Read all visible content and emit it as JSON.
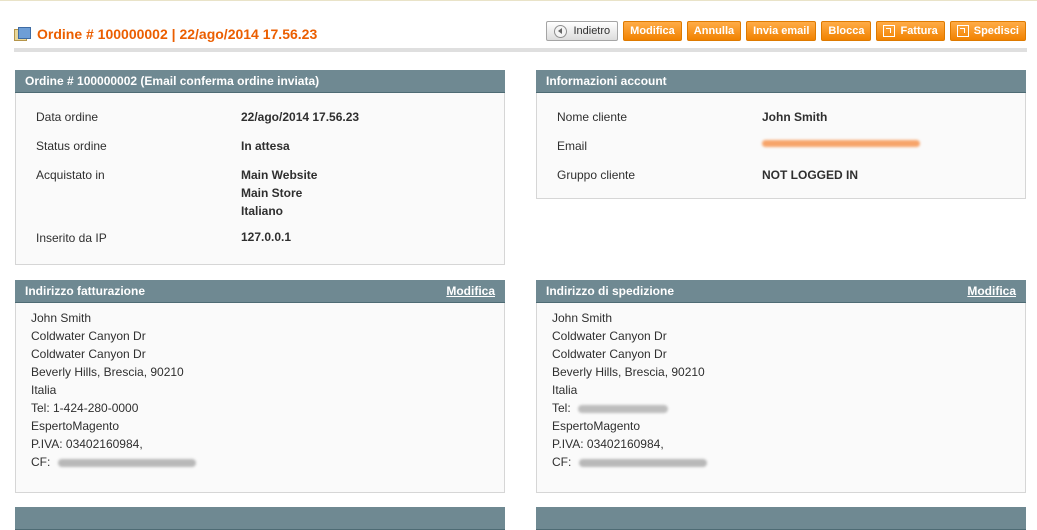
{
  "header": {
    "title": "Ordine # 100000002 | 22/ago/2014 17.56.23",
    "buttons": {
      "back": "Indietro",
      "edit": "Modifica",
      "cancel": "Annulla",
      "email": "Invia email",
      "hold": "Blocca",
      "invoice": "Fattura",
      "ship": "Spedisci"
    }
  },
  "order_box": {
    "title": "Ordine # 100000002 (Email conferma ordine inviata)",
    "rows": [
      {
        "label": "Data ordine",
        "value": "22/ago/2014 17.56.23"
      },
      {
        "label": "Status ordine",
        "value": "In attesa"
      },
      {
        "label": "Acquistato in",
        "value_lines": [
          "Main Website",
          "Main Store",
          "Italiano"
        ]
      },
      {
        "label": "Inserito da IP",
        "value": "127.0.0.1"
      }
    ]
  },
  "account_box": {
    "title": "Informazioni account",
    "rows": [
      {
        "label": "Nome cliente",
        "value": "John Smith"
      },
      {
        "label": "Email",
        "value": ""
      },
      {
        "label": "Gruppo cliente",
        "value": "NOT LOGGED IN"
      }
    ]
  },
  "billing_box": {
    "title": "Indirizzo fatturazione",
    "edit_link": "Modifica",
    "lines": [
      "John Smith",
      "Coldwater Canyon Dr",
      "Coldwater Canyon Dr",
      "Beverly Hills, Brescia, 90210",
      "Italia",
      "Tel: 1-424-280-0000",
      "EspertoMagento",
      "P.IVA: 03402160984,"
    ],
    "cf_label": "CF:"
  },
  "shipping_box": {
    "title": "Indirizzo di spedizione",
    "edit_link": "Modifica",
    "lines": [
      "John Smith",
      "Coldwater Canyon Dr",
      "Coldwater Canyon Dr",
      "Beverly Hills, Brescia, 90210",
      "Italia"
    ],
    "tel_label": "Tel:",
    "lines_after_tel": [
      "EspertoMagento",
      "P.IVA: 03402160984,"
    ],
    "cf_label": "CF:"
  },
  "colors": {
    "accent": "#eb5e00",
    "box_header": "#6f8992",
    "button": "#f18200"
  }
}
